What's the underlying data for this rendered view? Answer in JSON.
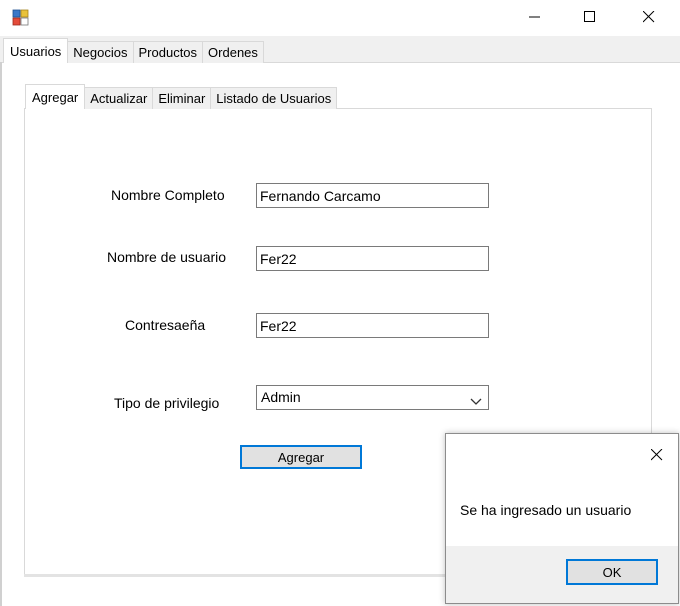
{
  "window": {
    "title_icon": "app-icon",
    "controls": [
      "minimize-icon",
      "maximize-icon",
      "close-icon"
    ]
  },
  "outer_tabs": [
    {
      "label": "Usuarios",
      "active": true
    },
    {
      "label": "Negocios",
      "active": false
    },
    {
      "label": "Productos",
      "active": false
    },
    {
      "label": "Ordenes",
      "active": false
    }
  ],
  "inner_tabs": [
    {
      "label": "Agregar",
      "active": true
    },
    {
      "label": "Actualizar",
      "active": false
    },
    {
      "label": "Eliminar",
      "active": false
    },
    {
      "label": "Listado de Usuarios",
      "active": false
    }
  ],
  "form": {
    "full_name_label": "Nombre Completo",
    "full_name_value": "Fernando Carcamo",
    "username_label": "Nombre de usuario",
    "username_value": "Fer22",
    "password_label": "Contresaeña",
    "password_value": "Fer22",
    "privilege_label": "Tipo de privilegio",
    "privilege_value": "Admin",
    "submit_label": "Agregar"
  },
  "dialog": {
    "message": "Se ha ingresado un usuario",
    "ok_label": "OK"
  },
  "colors": {
    "focus_border": "#0078d7",
    "window_bg": "#f0f0f0"
  }
}
